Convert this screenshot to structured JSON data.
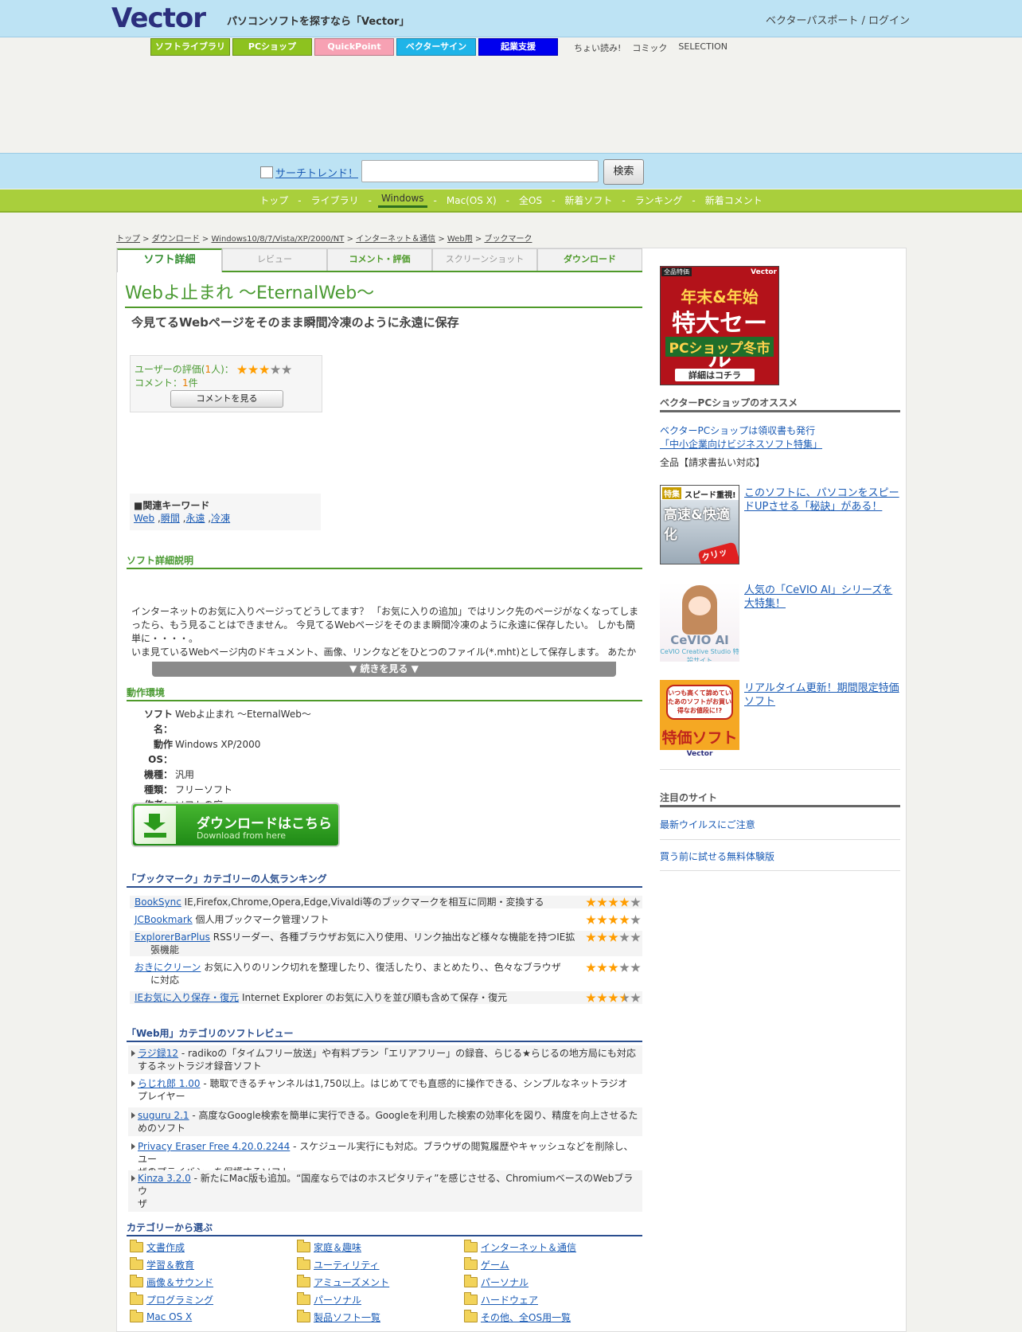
{
  "header": {
    "logo": "Vector",
    "tagline": "パソコンソフトを探すなら「Vector」",
    "login": "ベクターパスポート / ログイン",
    "nav_buttons": [
      {
        "label": "ソフトライブラリ",
        "color": "#8dc21f"
      },
      {
        "label": "PCショップ",
        "color": "#8dc21f"
      },
      {
        "label": "QuickPoint",
        "color": "#f7a1b3"
      },
      {
        "label": "ベクターサイン",
        "color": "#1fb4e8"
      },
      {
        "label": "起業支援",
        "color": "#0000ee"
      }
    ],
    "nav_links": [
      "ちょい読み!",
      "コミック",
      "SELECTION"
    ]
  },
  "search": {
    "trend_label": "サーチトレンド！",
    "input_value": "",
    "button": "検索"
  },
  "main_nav": {
    "items": [
      "トップ",
      "ライブラリ",
      "Windows",
      "Mac(OS X)",
      "全OS",
      "新着ソフト",
      "ランキング",
      "新着コメント"
    ],
    "separator": "-",
    "active": "Windows"
  },
  "breadcrumb": [
    "トップ",
    "ダウンロード",
    "Windows10/8/7/Vista/XP/2000/NT",
    "インターネット＆通信",
    "Web用",
    "ブックマーク"
  ],
  "tabs": [
    "ソフト詳細",
    "レビュー",
    "コメント・評価",
    "スクリーンショット",
    "ダウンロード"
  ],
  "software": {
    "title": "Webよ止まれ 〜EternalWeb〜",
    "subtitle": "今見てるWebページをそのまま瞬間冷凍のように永遠に保存",
    "rating": {
      "label_prefix": "ユーザーの評価(",
      "count": "1",
      "label_suffix": "人)：",
      "stars": 3,
      "comment_prefix": "コメント：",
      "comment_count": "1",
      "comment_suffix": "件",
      "button": "コメントを見る"
    },
    "keywords_title": "■関連キーワード",
    "keywords": [
      "Web",
      "瞬間",
      "永遠",
      "冷凍"
    ],
    "keyword_separator": " ,",
    "desc_title": "ソフト詳細説明",
    "desc_lines": [
      "インターネットのお気に入りページってどうしてます？ 「お気に入りの追加」ではリンク先のページがなくなってしまったら、もう見ることはできません。 今見てるWebページをそのまま瞬間冷凍のように永遠に保存したい。 しかも簡単に・・・・。",
      "いま見ているWebページ内のドキュメント、画像、リンクなどをひとつのファイル(*.mht)として保存します。 あたか"
    ],
    "more_button": "▼ 続きを見る ▼",
    "env_title": "動作環境",
    "env": [
      {
        "key": "ソフト名：",
        "value": "Webよ止まれ 〜EternalWeb〜"
      },
      {
        "key": "動作OS：",
        "value": "Windows XP/2000"
      },
      {
        "key": "機種：",
        "value": "汎用"
      },
      {
        "key": "種類：",
        "value": "フリーソフト"
      },
      {
        "key": "作者：",
        "value": "ソフトの庭"
      }
    ],
    "download": {
      "label": "ダウンロードはこちら",
      "sub": "Download from here"
    }
  },
  "ranking": {
    "title": "「ブックマーク」カテゴリーの人気ランキング",
    "items": [
      {
        "name": "BookSync",
        "desc": " IE,Firefox,Chrome,Opera,Edge,Vivaldi等のブックマークを相互に同期・変換する",
        "cont": "",
        "stars": 4
      },
      {
        "name": "JCBookmark",
        "desc": " 個人用ブックマーク管理ソフト",
        "cont": "",
        "stars": 4
      },
      {
        "name": "ExplorerBarPlus",
        "desc": " RSSリーダー、各種ブラウザお気に入り使用、リンク抽出など様々な機能を持つIE拡",
        "cont": "張機能",
        "stars": 3
      },
      {
        "name": "おきにクリーン",
        "desc": " お気に入りのリンク切れを整理したり、復活したり、まとめたり、、色々なブラウザ",
        "cont": "に対応",
        "stars": 3
      },
      {
        "name": "IEお気に入り保存・復元",
        "desc": " Internet Explorer のお気に入りを並び順も含めて保存・復元",
        "cont": "",
        "stars": 3.5
      }
    ]
  },
  "reviews": {
    "title": "「Web用」カテゴリのソフトレビュー",
    "items": [
      {
        "name": "ラジ録12",
        "l1": " - radikoの「タイムフリー放送」や有料プラン「エリアフリー」の録音、らじる★らじるの地方局にも対応",
        "l2": "するネットラジオ録音ソフト"
      },
      {
        "name": "らじれ郎 1.00",
        "l1": " - 聴取できるチャンネルは1,750以上。はじめてでも直感的に操作できる、シンプルなネットラジオ",
        "l2": "プレイヤー"
      },
      {
        "name": "suguru 2.1",
        "l1": " - 高度なGoogle検索を簡単に実行できる。Googleを利用した検索の効率化を図り、精度を向上させるた",
        "l2": "めのソフト"
      },
      {
        "name": "Privacy Eraser Free 4.20.0.2244",
        "l1": " - スケジュール実行にも対応。ブラウザの閲覧履歴やキャッシュなどを削除し、ユー",
        "l2": "ザのプライバシーを保護するソフト"
      },
      {
        "name": "Kinza 3.2.0",
        "l1": " - 新たにMac版も追加。“国産ならではのホスピタリティ”を感じさせる、ChromiumベースのWebブラウ",
        "l2": "ザ"
      }
    ]
  },
  "categories": {
    "title": "カテゴリーから選ぶ",
    "items": [
      "文書作成",
      "家庭＆趣味",
      "インターネット＆通信",
      "学習＆教育",
      "ユーティリティ",
      "ゲーム",
      "画像＆サウンド",
      "アミューズメント",
      "パーソナル",
      "プログラミング",
      "パーソナル",
      "ハードウェア",
      "Mac OS X",
      "製品ソフト一覧",
      "その他、全OS用一覧"
    ]
  },
  "sidebar": {
    "banner": {
      "label": "全品特価",
      "brand": "Vector",
      "l1": "年末&年始",
      "l2": "特大セール",
      "l3": "PCショップ冬市",
      "l4": "詳細はコチラ"
    },
    "shop_title": "ベクターPCショップのオススメ",
    "shop_link1": "ベクターPCショップは領収書も発行",
    "shop_link2": "「中小企業向けビジネスソフト特集」",
    "shop_note": "全品【請求書払い対応】",
    "cards": [
      {
        "text": "このソフトに、パソコンをスピードUPさせる「秘訣」がある！",
        "badge": "特集",
        "head": "スピード重視!",
        "big": "高速&快適化",
        "click": "クリック!"
      },
      {
        "text": "人気の「CeVIO AI」シリーズを大特集！",
        "logo": "CeVIO AI",
        "small": "CeVIO Creative Studio 特設サイト"
      },
      {
        "text": "リアルタイム更新！期間限定特価ソフト",
        "bubble": "いつも高くて諦めていたあのソフトがお買い得なお値段に!?",
        "special": "特価ソフト",
        "foot": "Vector"
      }
    ],
    "notice_title": "注目のサイト",
    "notice_links": [
      "最新ウイルスにご注意",
      "買う前に試せる無料体験版"
    ]
  }
}
